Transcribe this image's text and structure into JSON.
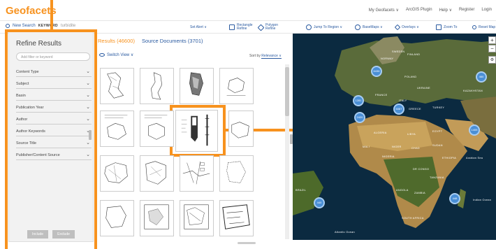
{
  "header": {
    "logo": "Geofacets",
    "links": [
      "My Geofacets ∨",
      "ArcGIS Plugin",
      "Help ∨",
      "Register",
      "Login"
    ]
  },
  "toolbar": {
    "new_search": "New Search",
    "keyword": "KEYWORD",
    "keyword_value": "turbidite",
    "set_alert": "Set Alert ∨",
    "rect_refine": "Rectangle Refine",
    "poly_refine": "Polygon Refine",
    "jump_region": "Jump To Region ∨",
    "basemaps": "BaseMaps ∨",
    "overlays": "Overlays ∨",
    "zoom_to": "Zoom To",
    "reset_map": "Reset Map"
  },
  "sidebar": {
    "title": "Refine Results",
    "filter_placeholder": "Add filter or keyword",
    "items": [
      {
        "label": "Content Type"
      },
      {
        "label": "Subject"
      },
      {
        "label": "Basin"
      },
      {
        "label": "Publication Year"
      },
      {
        "label": "Author"
      },
      {
        "label": "Author Keywords"
      },
      {
        "label": "Source Title"
      },
      {
        "label": "Publisher/Content Source"
      }
    ],
    "include": "Include",
    "exclude": "Exclude"
  },
  "results": {
    "results_tab": "Results (46600)",
    "documents_tab": "Source Documents (3701)",
    "switch_view": "Switch View ∨",
    "sort_label": "Sort by",
    "sort_value": "Relevance ∨"
  },
  "map": {
    "clusters": [
      "6436",
      "6087",
      "2420",
      "1405",
      "440",
      "460",
      "1281",
      "448"
    ],
    "labels": [
      "SWEDEN",
      "FINLAND",
      "NORWAY",
      "POLAND",
      "UKRAINE",
      "KAZAKHSTAN",
      "FRANCE",
      "ITALY",
      "GREECE",
      "TURKEY",
      "ALGERIA",
      "LIBYA",
      "EGYPT",
      "MALI",
      "NIGER",
      "SUDAN",
      "CHAD",
      "NIGERIA",
      "ETHIOPIA",
      "DR CONGO",
      "TANZANIA",
      "ANGOLA",
      "ZAMBIA",
      "SOUTH AFRICA",
      "BRAZIL",
      "Arabian Sea",
      "Indian Ocean",
      "Atlantic Ocean"
    ]
  }
}
